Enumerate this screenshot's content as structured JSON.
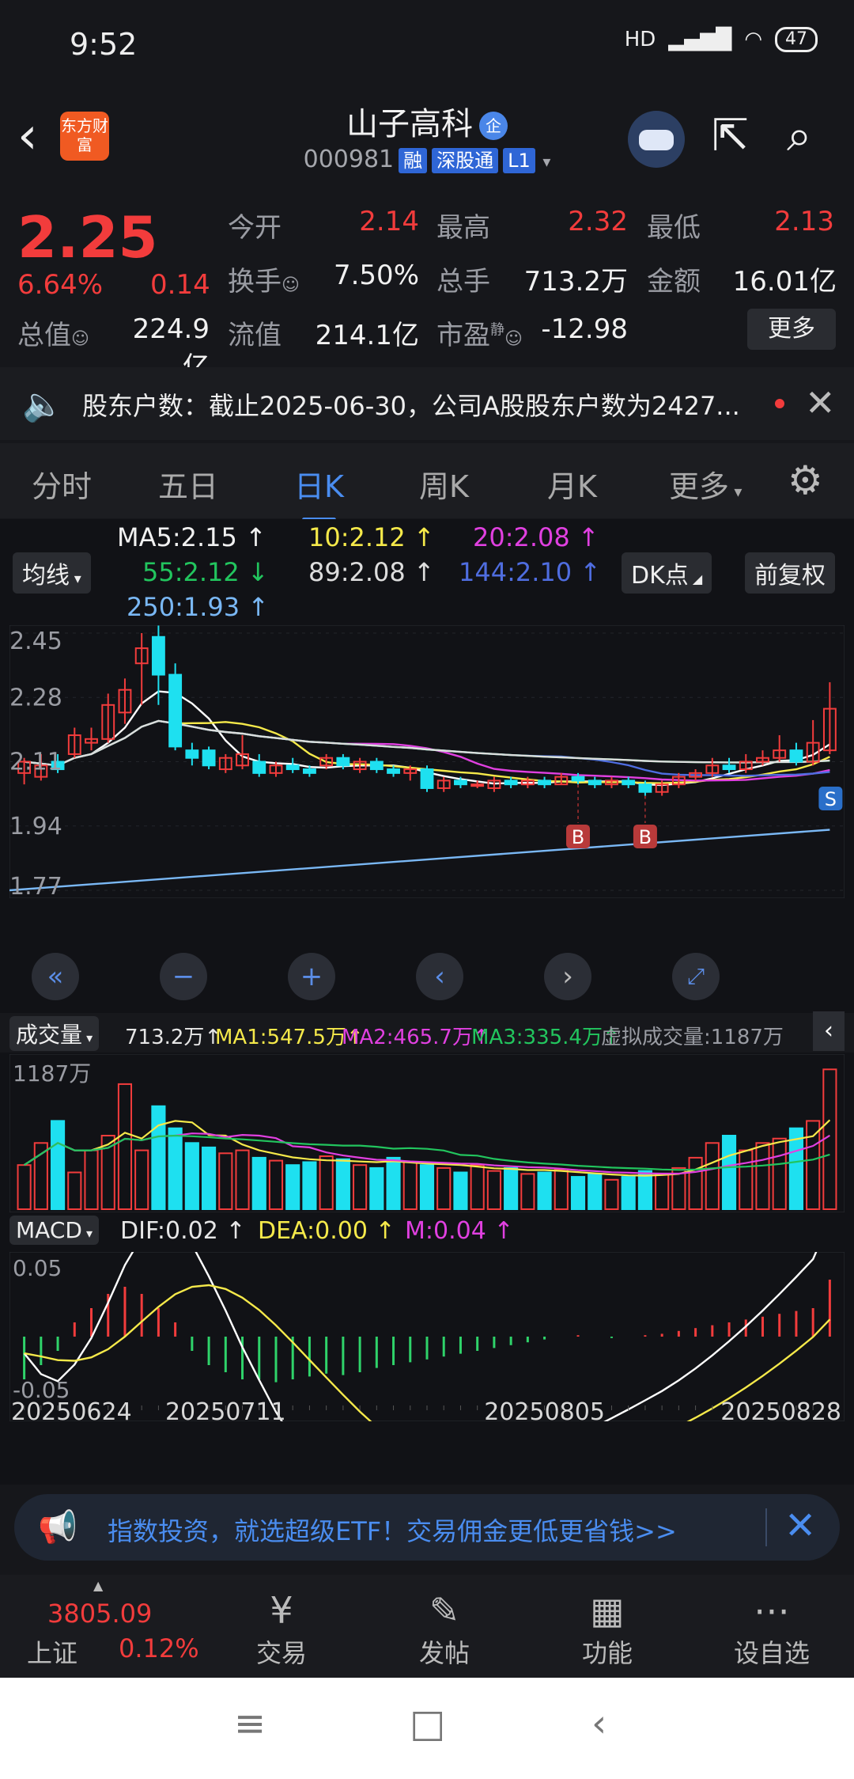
{
  "status_bar": {
    "time": "9:52",
    "network": "HD",
    "battery": "47"
  },
  "header": {
    "logo_text": "东方财富",
    "title": "山子高科",
    "title_badge": "企",
    "code": "000981",
    "tags": [
      "融",
      "深股通",
      "L1"
    ]
  },
  "quote": {
    "price": "2.25",
    "change_pct": "6.64%",
    "change": "0.14",
    "open_label": "今开",
    "open": "2.14",
    "high_label": "最高",
    "high": "2.32",
    "low_label": "最低",
    "low": "2.13",
    "turnover_label": "换手",
    "turnover": "7.50%",
    "volume_label": "总手",
    "volume": "713.2万",
    "amount_label": "金额",
    "amount": "16.01亿",
    "mktcap_label": "总值",
    "mktcap": "224.9亿",
    "float_label": "流值",
    "float_cap": "214.1亿",
    "pe_label": "市盈",
    "pe_sup": "静",
    "pe": "-12.98",
    "more": "更多"
  },
  "notice": {
    "text": "股东户数：截止2025-06-30，公司A股股东户数为2427..."
  },
  "tabs": [
    "分时",
    "五日",
    "日K",
    "周K",
    "月K",
    "更多"
  ],
  "active_tab": 2,
  "ma_legend": {
    "selector": "均线",
    "ma5": "MA5:2.15",
    "ma10": "10:2.12",
    "ma20": "20:2.08",
    "ma55": "55:2.12",
    "ma89": "89:2.08",
    "ma144": "144:2.10",
    "ma250": "250:1.93",
    "dk_button": "DK点",
    "adjust_button": "前复权",
    "colors": {
      "ma5": "#ffffff",
      "ma10": "#f5e94a",
      "ma20": "#e040e0",
      "ma55": "#22c55e",
      "ma89": "#dddddd",
      "ma144": "#4f6de0",
      "ma250": "#7ab8f5"
    }
  },
  "volume_legend": {
    "selector": "成交量",
    "vol": "713.2万",
    "ma1": "MA1:547.5万",
    "ma2": "MA2:465.7万",
    "ma3": "MA3:335.4万",
    "virtual": "虚拟成交量:1187万",
    "max_label": "1187万"
  },
  "macd_legend": {
    "selector": "MACD",
    "dif": "DIF:0.02",
    "dea": "DEA:0.00",
    "m": "M:0.04",
    "top_label": "0.05",
    "bottom_label": "-0.05"
  },
  "markers": {
    "buy": "B",
    "sell": "S"
  },
  "chart_data": {
    "type": "candlestick",
    "price_axis": [
      "2.45",
      "2.28",
      "2.11",
      "1.94",
      "1.77"
    ],
    "ylim": [
      1.77,
      2.45
    ],
    "dates": [
      "20250624",
      "20250711",
      "20250805",
      "20250828"
    ],
    "candles": [
      {
        "o": 2.08,
        "c": 2.11,
        "h": 2.12,
        "l": 2.05
      },
      {
        "o": 2.07,
        "c": 2.1,
        "h": 2.13,
        "l": 2.06
      },
      {
        "o": 2.11,
        "c": 2.09,
        "h": 2.13,
        "l": 2.08
      },
      {
        "o": 2.13,
        "c": 2.18,
        "h": 2.2,
        "l": 2.12
      },
      {
        "o": 2.16,
        "c": 2.17,
        "h": 2.2,
        "l": 2.14
      },
      {
        "o": 2.17,
        "c": 2.26,
        "h": 2.29,
        "l": 2.16
      },
      {
        "o": 2.24,
        "c": 2.3,
        "h": 2.33,
        "l": 2.21
      },
      {
        "o": 2.37,
        "c": 2.41,
        "h": 2.45,
        "l": 2.26
      },
      {
        "o": 2.44,
        "c": 2.34,
        "h": 2.47,
        "l": 2.26
      },
      {
        "o": 2.34,
        "c": 2.15,
        "h": 2.37,
        "l": 2.14
      },
      {
        "o": 2.14,
        "c": 2.12,
        "h": 2.16,
        "l": 2.1
      },
      {
        "o": 2.14,
        "c": 2.1,
        "h": 2.15,
        "l": 2.09
      },
      {
        "o": 2.09,
        "c": 2.12,
        "h": 2.13,
        "l": 2.08
      },
      {
        "o": 2.1,
        "c": 2.13,
        "h": 2.18,
        "l": 2.09
      },
      {
        "o": 2.11,
        "c": 2.08,
        "h": 2.13,
        "l": 2.07
      },
      {
        "o": 2.08,
        "c": 2.1,
        "h": 2.11,
        "l": 2.07
      },
      {
        "o": 2.1,
        "c": 2.09,
        "h": 2.12,
        "l": 2.08
      },
      {
        "o": 2.09,
        "c": 2.08,
        "h": 2.1,
        "l": 2.07
      },
      {
        "o": 2.1,
        "c": 2.12,
        "h": 2.13,
        "l": 2.09
      },
      {
        "o": 2.12,
        "c": 2.1,
        "h": 2.13,
        "l": 2.09
      },
      {
        "o": 2.09,
        "c": 2.11,
        "h": 2.12,
        "l": 2.08
      },
      {
        "o": 2.11,
        "c": 2.09,
        "h": 2.12,
        "l": 2.08
      },
      {
        "o": 2.09,
        "c": 2.08,
        "h": 2.1,
        "l": 2.07
      },
      {
        "o": 2.08,
        "c": 2.09,
        "h": 2.1,
        "l": 2.06
      },
      {
        "o": 2.09,
        "c": 2.04,
        "h": 2.1,
        "l": 2.03
      },
      {
        "o": 2.04,
        "c": 2.06,
        "h": 2.07,
        "l": 2.03
      },
      {
        "o": 2.06,
        "c": 2.05,
        "h": 2.07,
        "l": 2.04
      },
      {
        "o": 2.05,
        "c": 2.05,
        "h": 2.06,
        "l": 2.04
      },
      {
        "o": 2.04,
        "c": 2.06,
        "h": 2.07,
        "l": 2.03
      },
      {
        "o": 2.06,
        "c": 2.05,
        "h": 2.07,
        "l": 2.04
      },
      {
        "o": 2.05,
        "c": 2.06,
        "h": 2.07,
        "l": 2.04
      },
      {
        "o": 2.06,
        "c": 2.05,
        "h": 2.07,
        "l": 2.04
      },
      {
        "o": 2.05,
        "c": 2.07,
        "h": 2.08,
        "l": 2.05
      },
      {
        "o": 2.07,
        "c": 2.06,
        "h": 2.08,
        "l": 2.05
      },
      {
        "o": 2.06,
        "c": 2.05,
        "h": 2.07,
        "l": 2.04
      },
      {
        "o": 2.05,
        "c": 2.06,
        "h": 2.07,
        "l": 2.04
      },
      {
        "o": 2.06,
        "c": 2.05,
        "h": 2.07,
        "l": 2.04
      },
      {
        "o": 2.05,
        "c": 2.03,
        "h": 2.06,
        "l": 2.02
      },
      {
        "o": 2.03,
        "c": 2.05,
        "h": 2.06,
        "l": 2.02
      },
      {
        "o": 2.05,
        "c": 2.07,
        "h": 2.08,
        "l": 2.04
      },
      {
        "o": 2.07,
        "c": 2.08,
        "h": 2.09,
        "l": 2.06
      },
      {
        "o": 2.08,
        "c": 2.1,
        "h": 2.12,
        "l": 2.07
      },
      {
        "o": 2.1,
        "c": 2.09,
        "h": 2.12,
        "l": 2.08
      },
      {
        "o": 2.09,
        "c": 2.11,
        "h": 2.13,
        "l": 2.08
      },
      {
        "o": 2.11,
        "c": 2.12,
        "h": 2.14,
        "l": 2.1
      },
      {
        "o": 2.12,
        "c": 2.14,
        "h": 2.18,
        "l": 2.11
      },
      {
        "o": 2.14,
        "c": 2.11,
        "h": 2.16,
        "l": 2.1
      },
      {
        "o": 2.11,
        "c": 2.16,
        "h": 2.22,
        "l": 2.1
      },
      {
        "o": 2.14,
        "c": 2.25,
        "h": 2.32,
        "l": 2.13
      }
    ],
    "volume": [
      30,
      45,
      60,
      25,
      40,
      50,
      85,
      40,
      70,
      55,
      45,
      42,
      38,
      40,
      35,
      33,
      30,
      32,
      36,
      34,
      30,
      28,
      35,
      32,
      30,
      28,
      25,
      30,
      26,
      28,
      24,
      25,
      27,
      22,
      24,
      20,
      22,
      26,
      24,
      28,
      35,
      45,
      50,
      40,
      45,
      48,
      55,
      60,
      95
    ],
    "macd_hist": [
      -0.03,
      -0.02,
      -0.01,
      0.01,
      0.02,
      0.03,
      0.035,
      0.03,
      0.02,
      0.01,
      -0.01,
      -0.02,
      -0.025,
      -0.03,
      -0.03,
      -0.032,
      -0.03,
      -0.028,
      -0.026,
      -0.027,
      -0.025,
      -0.022,
      -0.02,
      -0.018,
      -0.016,
      -0.014,
      -0.012,
      -0.01,
      -0.008,
      -0.006,
      -0.004,
      -0.002,
      0.0,
      0.001,
      0.0,
      -0.001,
      0.0,
      0.001,
      0.002,
      0.004,
      0.006,
      0.008,
      0.01,
      0.012,
      0.014,
      0.016,
      0.018,
      0.02,
      0.04
    ]
  },
  "ad": {
    "text": "指数投资，就选超级ETF！交易佣金更低更省钱>>"
  },
  "bottom_nav": {
    "index_value": "3805.09",
    "index_name": "上证",
    "index_pct": "0.12%",
    "items": [
      "交易",
      "发帖",
      "功能",
      "设自选"
    ]
  }
}
